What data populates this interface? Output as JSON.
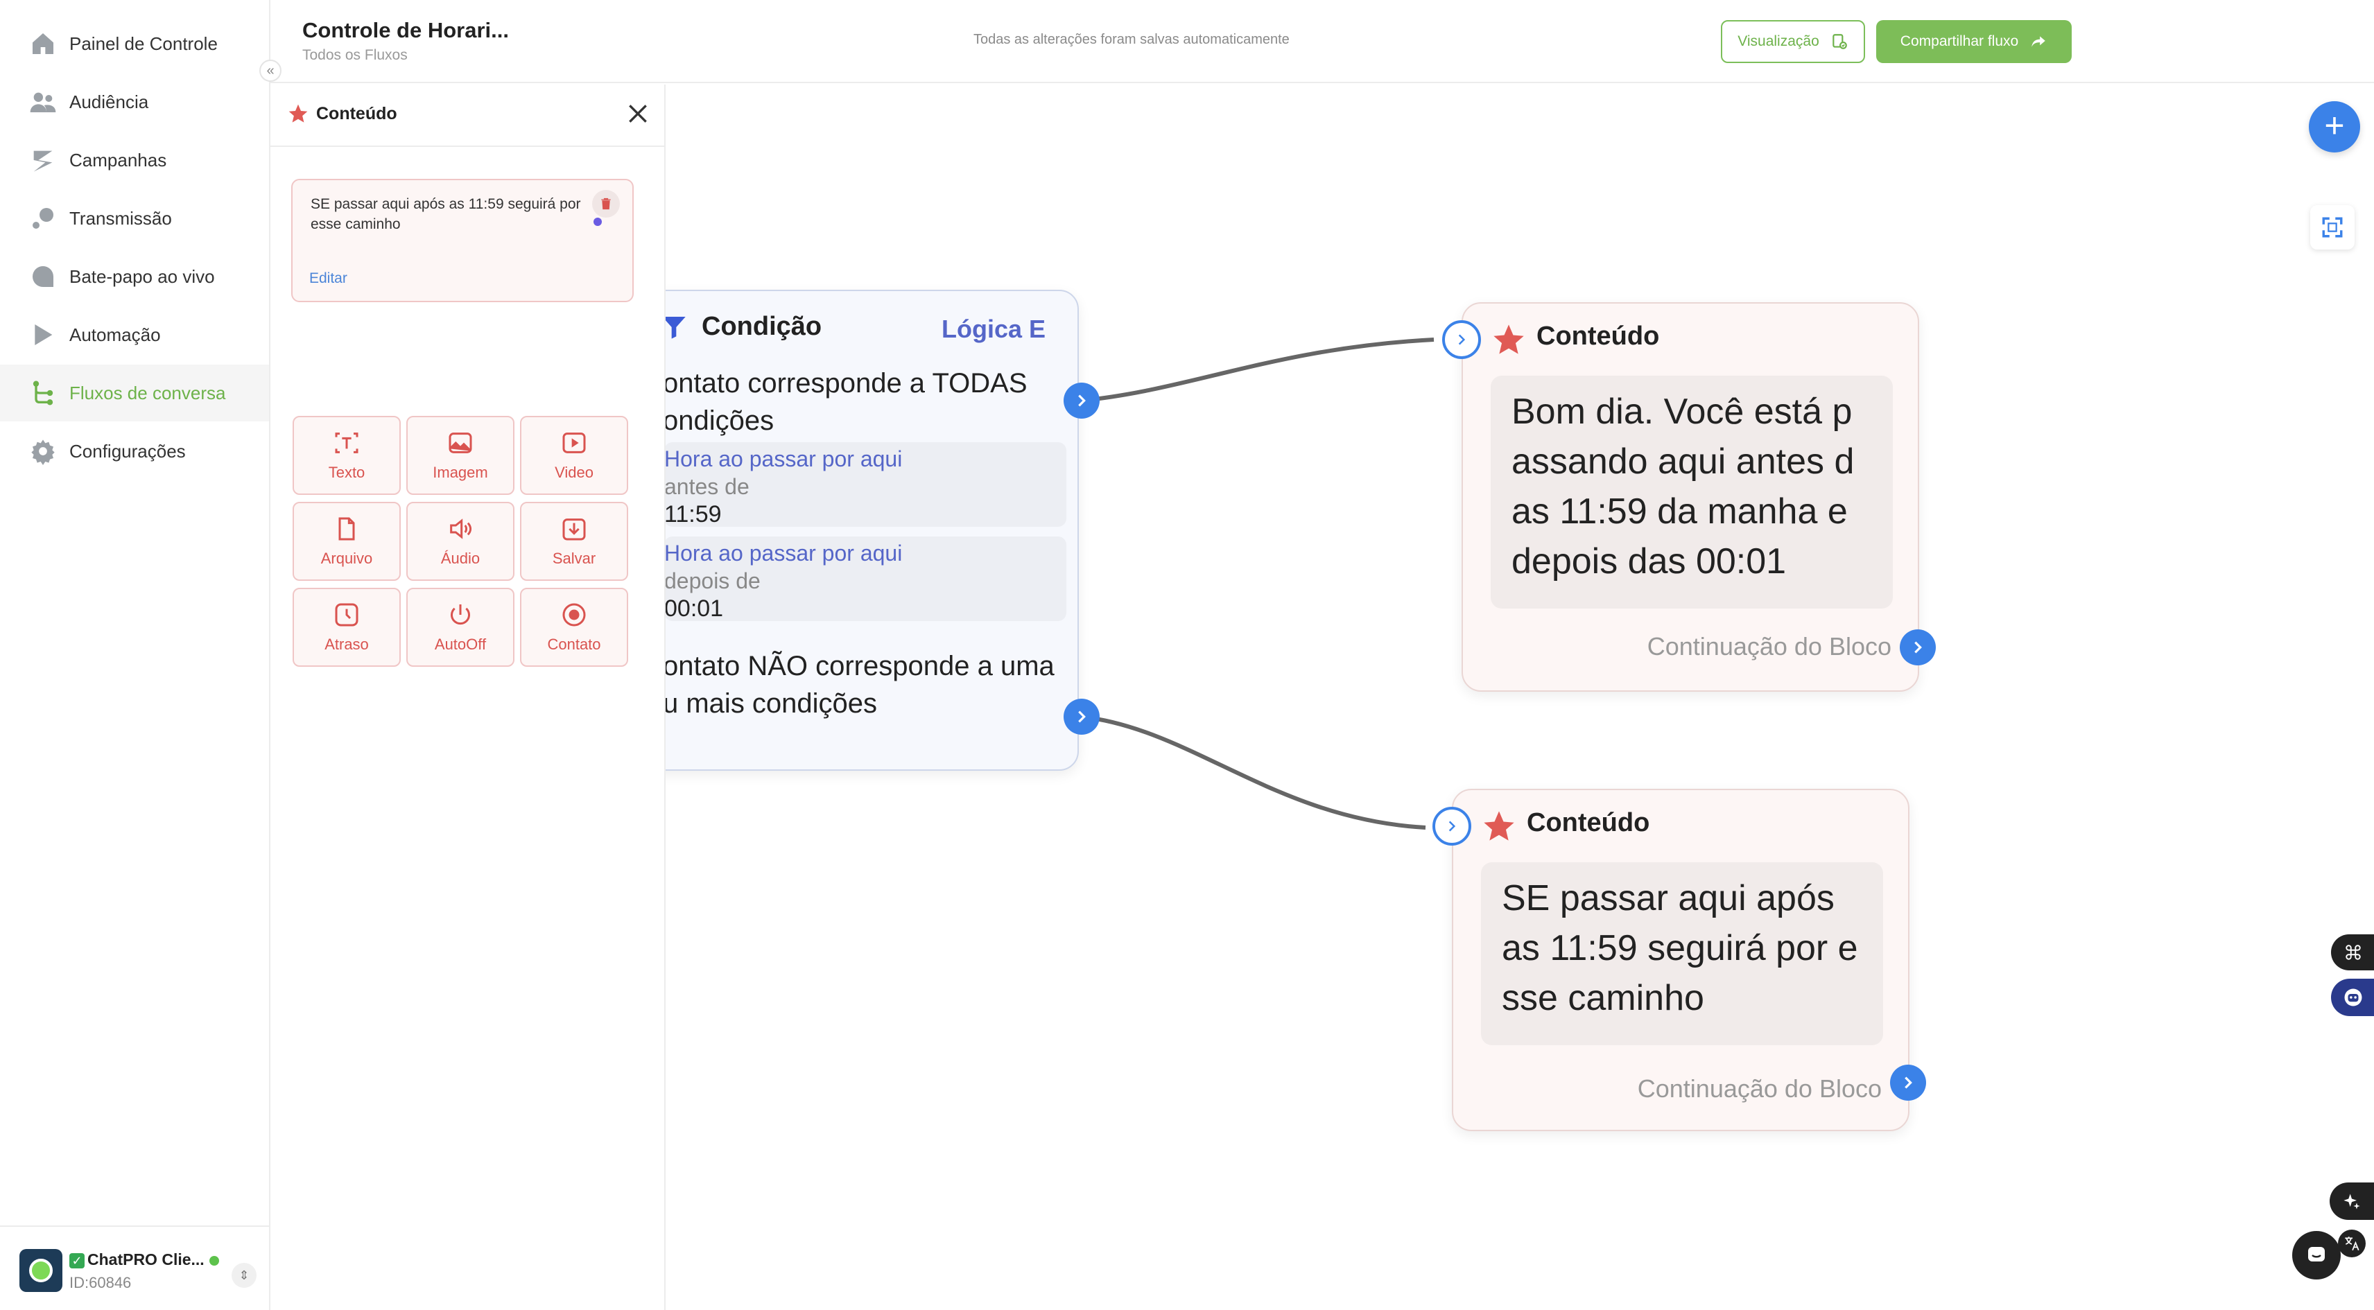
{
  "sidebar": {
    "items": [
      {
        "label": "Painel de Controle",
        "icon": "home-icon"
      },
      {
        "label": "Audiência",
        "icon": "users-icon"
      },
      {
        "label": "Campanhas",
        "icon": "campaign-icon"
      },
      {
        "label": "Transmissão",
        "icon": "broadcast-icon"
      },
      {
        "label": "Bate-papo ao vivo",
        "icon": "chat-icon"
      },
      {
        "label": "Automação",
        "icon": "automation-icon"
      },
      {
        "label": "Fluxos de conversa",
        "icon": "flow-icon",
        "active": true
      },
      {
        "label": "Configurações",
        "icon": "gear-icon"
      }
    ],
    "account": {
      "name": "ChatPRO Clie...",
      "id": "ID:60846"
    }
  },
  "header": {
    "title": "Controle de Horari...",
    "breadcrumb": "Todos os Fluxos",
    "saved_status": "Todas as alterações foram salvas automaticamente",
    "preview_label": "Visualização",
    "share_label": "Compartilhar fluxo"
  },
  "panel": {
    "title": "Conteúdo",
    "message": "SE passar aqui após as 11:59 seguirá por esse caminho",
    "edit_label": "Editar",
    "tools": [
      {
        "label": "Texto",
        "icon": "text-icon"
      },
      {
        "label": "Imagem",
        "icon": "image-icon"
      },
      {
        "label": "Video",
        "icon": "video-icon"
      },
      {
        "label": "Arquivo",
        "icon": "file-icon"
      },
      {
        "label": "Áudio",
        "icon": "audio-icon"
      },
      {
        "label": "Salvar",
        "icon": "save-icon"
      },
      {
        "label": "Atraso",
        "icon": "clock-icon"
      },
      {
        "label": "AutoOff",
        "icon": "power-icon"
      },
      {
        "label": "Contato",
        "icon": "contact-icon"
      }
    ]
  },
  "canvas": {
    "condition": {
      "title": "Condição",
      "logic": "Lógica E",
      "match_all": "ontato corresponde a TODAS ondições",
      "rules": [
        {
          "name": "Hora ao passar por aqui",
          "op": "antes de",
          "value": "11:59"
        },
        {
          "name": "Hora ao passar por aqui",
          "op": "depois de",
          "value": "00:01"
        }
      ],
      "match_none": "ontato NÃO corresponde a uma u mais condições"
    },
    "content_top": {
      "title": "Conteúdo",
      "text": "Bom dia. Você está passando aqui antes das 11:59 da manha e depois das 00:01",
      "continue_label": "Continuação do Bloco"
    },
    "content_bottom": {
      "title": "Conteúdo",
      "text": "SE passar aqui após as 11:59 seguirá por esse caminho",
      "continue_label": "Continuação do Bloco"
    }
  },
  "colors": {
    "accent_green": "#6db24a",
    "accent_blue": "#3b82e8",
    "content_red": "#d9534f",
    "logic_blue": "#5566c8"
  }
}
